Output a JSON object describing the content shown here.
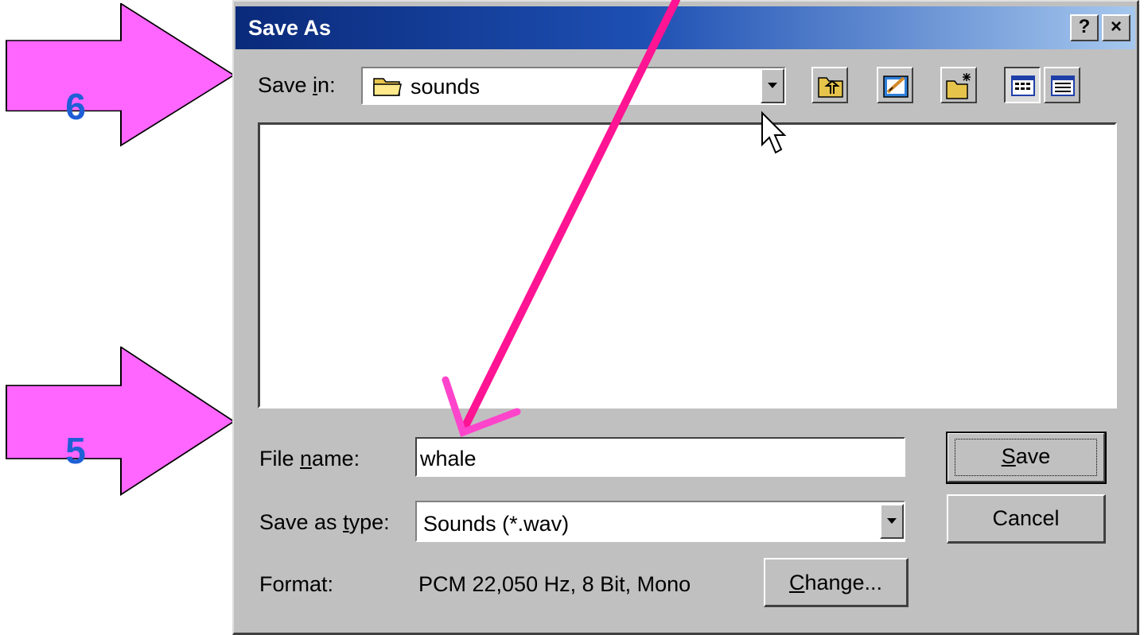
{
  "callouts": [
    {
      "number": "6",
      "color": "#ff66ff"
    },
    {
      "number": "5",
      "color": "#ff66ff"
    }
  ],
  "dialog": {
    "title": "Save As",
    "help_label": "?",
    "close_label": "×",
    "save_in": {
      "label_prefix": "Save ",
      "label_accel": "i",
      "label_suffix": "n:",
      "value": "sounds",
      "icon": "folder-icon"
    },
    "toolbar": [
      {
        "name": "up-one-level-icon"
      },
      {
        "name": "view-desktop-icon"
      },
      {
        "name": "create-new-folder-icon"
      },
      {
        "name": "list-view-icon"
      },
      {
        "name": "details-view-icon"
      }
    ],
    "file_name": {
      "label_prefix": "File ",
      "label_accel": "n",
      "label_suffix": "ame:",
      "value": "whale"
    },
    "save_as_type": {
      "label_prefix": "Save as ",
      "label_accel": "t",
      "label_suffix": "ype:",
      "value": "Sounds (*.wav)"
    },
    "format": {
      "label": "Format:",
      "value": "PCM 22,050 Hz, 8 Bit, Mono"
    },
    "buttons": {
      "save_accel": "S",
      "save_rest": "ave",
      "cancel": "Cancel",
      "change_accel": "C",
      "change_rest": "hange..."
    }
  },
  "colors": {
    "arrow": "#ff66ff",
    "callout_number": "#1f5fd6",
    "pointer_arrow": "#ff1493",
    "titlebar": "#0a2a7a"
  }
}
